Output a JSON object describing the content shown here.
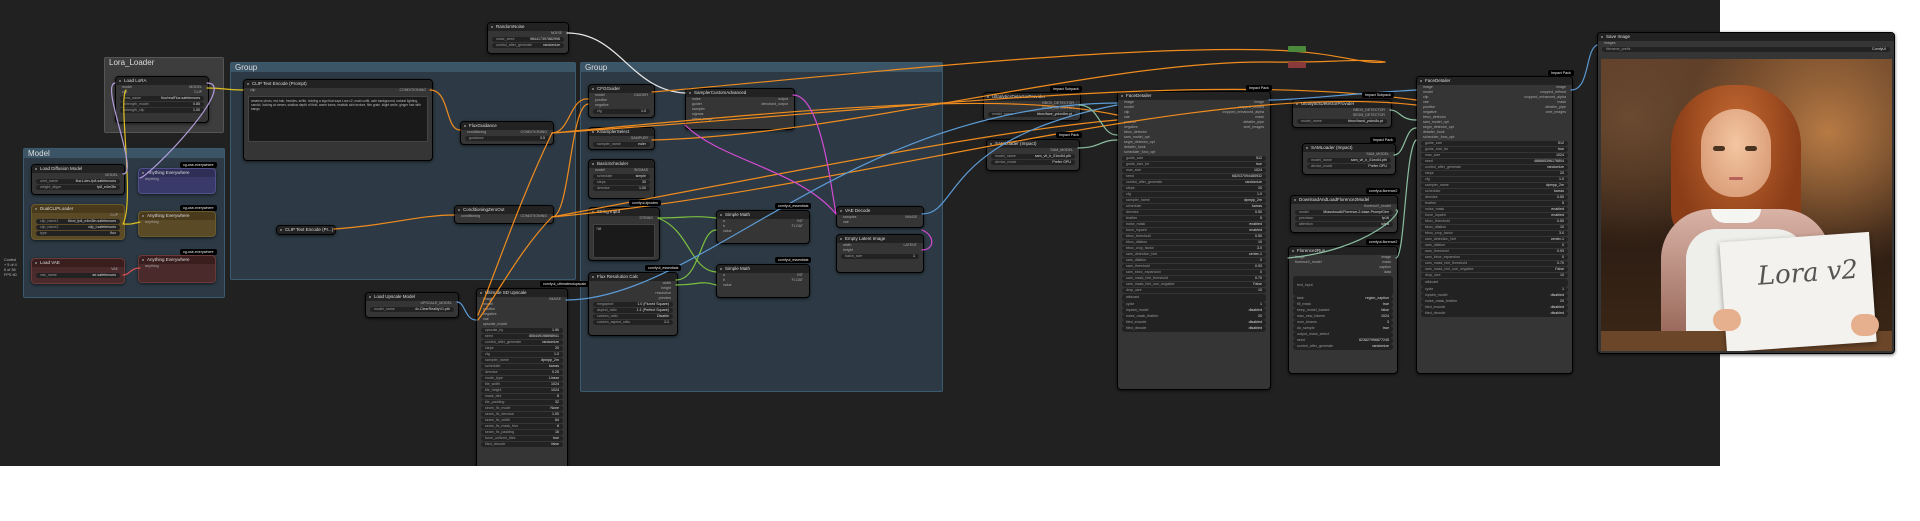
{
  "groups": {
    "lora": "Lora_Loader",
    "group1": "Group",
    "group2": "Group",
    "model": "Model"
  },
  "nodes": {
    "random_noise": {
      "title": "RandomNoise",
      "out": "NOISE",
      "w1": [
        "noise_seed",
        "984417397882996"
      ],
      "w2": [
        "control_after_generate",
        "randomize"
      ]
    },
    "load_lora": {
      "title": "Load LoRA",
      "ins": [
        "model",
        "clip"
      ],
      "outs": [
        "MODEL",
        "CLIP"
      ],
      "w1": [
        "lora_name",
        "flux/realFlux.safetensors"
      ],
      "w2": [
        "strength_model",
        "0.85"
      ],
      "w3": [
        "strength_clip",
        "1.00"
      ]
    },
    "clip_text": {
      "title": "CLIP Text Encode (Prompt)",
      "in": "clip",
      "out": "CONDITIONING",
      "text": "amateur photo, red-hair, freckles, selfie, holding a sign that says Lora v2, maid outfit, cafe background, natural lighting, candid, looking at viewer, shallow depth of field, warm tones, realistic skin texture, film grain, slight smile, ginger hair with bangs"
    },
    "flux_guidance": {
      "title": "FluxGuidance",
      "in": "conditioning",
      "out": "CONDITIONING",
      "w1": [
        "guidance",
        "3.5"
      ]
    },
    "cond_zero": {
      "title": "ConditioningZeroOut",
      "in": "conditioning",
      "out": "CONDITIONING"
    },
    "clip_text_neg": {
      "title": "CLIP Text Encode (Pr...)"
    },
    "load_diffusion": {
      "title": "Load Diffusion Model",
      "out": "MODEL",
      "w1": [
        "unet_name",
        "flux1-dev-fp8.safetensors"
      ],
      "w2": [
        "weight_dtype",
        "fp8_e4m3fn"
      ]
    },
    "dual_clip": {
      "title": "DualCLIPLoader",
      "out": "CLIP",
      "w1": [
        "clip_name1",
        "t5xxl_fp8_e4m3fn.safetensors"
      ],
      "w2": [
        "clip_name2",
        "clip_l.safetensors"
      ],
      "w3": [
        "type",
        "flux"
      ]
    },
    "load_vae": {
      "title": "Load VAE",
      "out": "VAE",
      "w1": [
        "vae_name",
        "ae.safetensors"
      ]
    },
    "anything_1": {
      "title": "Anything Everywhere",
      "in": "anything"
    },
    "anything_2": {
      "title": "Anything Everywhere",
      "in": "anything"
    },
    "anything_3": {
      "title": "Anything Everywhere",
      "in": "anything"
    },
    "cfg_guider": {
      "title": "CFGGuider",
      "ins": [
        "model",
        "positive",
        "negative"
      ],
      "out": "GUIDER",
      "w1": [
        "cfg",
        "1.0"
      ]
    },
    "ksampler_select": {
      "title": "KSamplerSelect",
      "out": "SAMPLER",
      "w1": [
        "sampler_name",
        "euler"
      ]
    },
    "basic_scheduler": {
      "title": "BasicScheduler",
      "in": "model",
      "out": "SIGMAS",
      "w1": [
        "scheduler",
        "simple"
      ],
      "w2": [
        "steps",
        "30"
      ],
      "w3": [
        "denoise",
        "1.00"
      ]
    },
    "sampler_custom": {
      "title": "SamplerCustomAdvanced",
      "ins": [
        "noise",
        "guider",
        "sampler",
        "sigmas",
        "latent_image"
      ],
      "outs": [
        "output",
        "denoised_output"
      ]
    },
    "string_input": {
      "title": "String Input",
      "out": "STRING",
      "text": "768"
    },
    "simple_math_1": {
      "title": "Simple Math",
      "ins": [
        "a",
        "b",
        "value"
      ],
      "outs": [
        "INT",
        "FLOAT"
      ]
    },
    "simple_math_2": {
      "title": "Simple Math",
      "ins": [
        "a",
        "b",
        "value"
      ],
      "outs": [
        "INT",
        "FLOAT"
      ]
    },
    "vae_decode": {
      "title": "VAE Decode",
      "ins": [
        "samples",
        "vae"
      ],
      "out": "IMAGE"
    },
    "empty_latent": {
      "title": "Empty Latent Image",
      "ins": [
        "width",
        "height"
      ],
      "out": "LATENT",
      "w1": [
        "batch_size",
        "1"
      ]
    },
    "flux_resolution": {
      "title": "Flux Resolution Calc",
      "outs": [
        "width",
        "height",
        "resolution",
        "preview"
      ],
      "w1": [
        "megapixel",
        "1.0 (Fluxed Square)"
      ],
      "w2": [
        "aspect_ratio",
        "1:1 (Perfect Square)"
      ],
      "w3": [
        "custom_ratio",
        "Disable"
      ],
      "w4": [
        "custom_aspect_ratio",
        "1:1"
      ]
    },
    "load_upscale": {
      "title": "Load Upscale Model",
      "out": "UPSCALE_MODEL",
      "w1": [
        "model_name",
        "4x-ClearRealityV1.pth"
      ]
    },
    "ultimate_sd": {
      "title": "Ultimate SD Upscale",
      "ins": [
        "image",
        "model",
        "positive",
        "negative",
        "vae",
        "upscale_model"
      ],
      "out": "IMAGE",
      "widgets": [
        [
          "upscale_by",
          "1.50"
        ],
        [
          "seed",
          "855449198698941"
        ],
        [
          "control_after_generate",
          "randomize"
        ],
        [
          "steps",
          "20"
        ],
        [
          "cfg",
          "1.0"
        ],
        [
          "sampler_name",
          "dpmpp_2m"
        ],
        [
          "scheduler",
          "karras"
        ],
        [
          "denoise",
          "0.25"
        ],
        [
          "mode_type",
          "Linear"
        ],
        [
          "tile_width",
          "1024"
        ],
        [
          "tile_height",
          "1024"
        ],
        [
          "mask_blur",
          "8"
        ],
        [
          "tile_padding",
          "32"
        ],
        [
          "seam_fix_mode",
          "None"
        ],
        [
          "seam_fix_denoise",
          "1.00"
        ],
        [
          "seam_fix_width",
          "64"
        ],
        [
          "seam_fix_mask_blur",
          "8"
        ],
        [
          "seam_fix_padding",
          "16"
        ],
        [
          "force_uniform_tiles",
          "true"
        ],
        [
          "tiled_decode",
          "false"
        ]
      ]
    },
    "ultra_provider_1": {
      "title": "UltralyticsDetectorProvider",
      "outs": [
        "BBOX_DETECTOR",
        "SEGM_DETECTOR"
      ],
      "w1": [
        "model_name",
        "bbox/face_yolov8m.pt"
      ]
    },
    "sam_loader_1": {
      "title": "SAMLoader (Impact)",
      "out": "SAM_MODEL",
      "w1": [
        "model_name",
        "sam_vit_b_01ec64.pth"
      ],
      "w2": [
        "device_mode",
        "Prefer GPU"
      ]
    },
    "face_detailer_1": {
      "title": "FaceDetailer",
      "ins": [
        "image",
        "model",
        "clip",
        "vae",
        "positive",
        "negative",
        "bbox_detector",
        "sam_model_opt",
        "segm_detector_opt",
        "detailer_hook",
        "scheduler_func_opt"
      ],
      "outs": [
        "image",
        "cropped_refined",
        "cropped_enhanced_alpha",
        "mask",
        "detailer_pipe",
        "cnet_images"
      ],
      "widgets": [
        [
          "guide_size",
          "512"
        ],
        [
          "guide_size_for",
          "true"
        ],
        [
          "max_size",
          "1024"
        ],
        [
          "seed",
          "682037094485932"
        ],
        [
          "control_after_generate",
          "randomize"
        ],
        [
          "steps",
          "20"
        ],
        [
          "cfg",
          "1.0"
        ],
        [
          "sampler_name",
          "dpmpp_2m"
        ],
        [
          "scheduler",
          "karras"
        ],
        [
          "denoise",
          "0.50"
        ],
        [
          "feather",
          "5"
        ],
        [
          "noise_mask",
          "enabled"
        ],
        [
          "force_inpaint",
          "enabled"
        ],
        [
          "bbox_threshold",
          "0.50"
        ],
        [
          "bbox_dilation",
          "10"
        ],
        [
          "bbox_crop_factor",
          "3.0"
        ],
        [
          "sam_detection_hint",
          "center-1"
        ],
        [
          "sam_dilation",
          "0"
        ],
        [
          "sam_threshold",
          "0.93"
        ],
        [
          "sam_bbox_expansion",
          "0"
        ],
        [
          "sam_mask_hint_threshold",
          "0.70"
        ],
        [
          "sam_mask_hint_use_negative",
          "False"
        ],
        [
          "drop_size",
          "10"
        ]
      ],
      "wildcard": [
        "wildcard",
        ""
      ],
      "extra": [
        [
          "cycle",
          "1"
        ],
        [
          "inpaint_model",
          "disabled"
        ],
        [
          "noise_mask_feather",
          "20"
        ],
        [
          "tiled_encode",
          "disabled"
        ],
        [
          "tiled_decode",
          "disabled"
        ]
      ]
    },
    "ultra_provider_2": {
      "title": "UltralyticsDetectorProvider",
      "outs": [
        "BBOX_DETECTOR",
        "SEGM_DETECTOR"
      ],
      "w1": [
        "model_name",
        "bbox/hand_yolov8s.pt"
      ]
    },
    "sam_loader_2": {
      "title": "SAMLoader (Impact)",
      "out": "SAM_MODEL",
      "w1": [
        "model_name",
        "sam_vit_b_01ec64.pth"
      ],
      "w2": [
        "device_mode",
        "Prefer GPU"
      ]
    },
    "downloader": {
      "title": "DownloadAndLoadFlorence2Model",
      "out": "florence2_model",
      "w1": [
        "model",
        "MiaoshouAI/Florence-2-base-PromptGen"
      ],
      "w2": [
        "precision",
        "fp16"
      ],
      "w3": [
        "attention",
        "sdpa"
      ]
    },
    "florence_run": {
      "title": "Florence2Run",
      "ins": [
        "image",
        "florence2_model"
      ],
      "outs": [
        "image",
        "mask",
        "caption",
        "data"
      ],
      "widgets": [
        [
          "text_input",
          ""
        ],
        [
          "task",
          "region_caption"
        ],
        [
          "fill_mask",
          "true"
        ],
        [
          "keep_model_loaded",
          "false"
        ],
        [
          "max_new_tokens",
          "1024"
        ],
        [
          "num_beams",
          "3"
        ],
        [
          "do_sample",
          "true"
        ],
        [
          "output_mask_select",
          ""
        ],
        [
          "seed",
          "823827996877245"
        ],
        [
          "control_after_generate",
          "randomize"
        ]
      ]
    },
    "face_detailer_2": {
      "title": "FaceDetailer",
      "ins": [
        "image",
        "model",
        "clip",
        "vae",
        "positive",
        "negative",
        "bbox_detector",
        "sam_model_opt",
        "segm_detector_opt",
        "detailer_hook",
        "scheduler_func_opt"
      ],
      "outs": [
        "image",
        "cropped_refined",
        "cropped_enhanced_alpha",
        "mask",
        "detailer_pipe",
        "cnet_images"
      ],
      "widgets": [
        [
          "guide_size",
          "512"
        ],
        [
          "guide_size_for",
          "true"
        ],
        [
          "max_size",
          "1024"
        ],
        [
          "seed",
          "488665396178804"
        ],
        [
          "control_after_generate",
          "randomize"
        ],
        [
          "steps",
          "20"
        ],
        [
          "cfg",
          "1.0"
        ],
        [
          "sampler_name",
          "dpmpp_2m"
        ],
        [
          "scheduler",
          "karras"
        ],
        [
          "denoise",
          "0.50"
        ],
        [
          "feather",
          "5"
        ],
        [
          "noise_mask",
          "enabled"
        ],
        [
          "force_inpaint",
          "enabled"
        ],
        [
          "bbox_threshold",
          "0.50"
        ],
        [
          "bbox_dilation",
          "10"
        ],
        [
          "bbox_crop_factor",
          "3.0"
        ],
        [
          "sam_detection_hint",
          "center-1"
        ],
        [
          "sam_dilation",
          "0"
        ],
        [
          "sam_threshold",
          "0.93"
        ],
        [
          "sam_bbox_expansion",
          "0"
        ],
        [
          "sam_mask_hint_threshold",
          "0.70"
        ],
        [
          "sam_mask_hint_use_negative",
          "False"
        ],
        [
          "drop_size",
          "10"
        ]
      ],
      "wildcard": [
        "wildcard",
        ""
      ],
      "extra": [
        [
          "cycle",
          "1"
        ],
        [
          "inpaint_model",
          "disabled"
        ],
        [
          "noise_mask_feather",
          "20"
        ],
        [
          "tiled_encode",
          "disabled"
        ],
        [
          "tiled_decode",
          "disabled"
        ]
      ]
    },
    "save_image": {
      "title": "Save Image",
      "in": "images",
      "w1": [
        "filename_prefix",
        "ComfyUI"
      ],
      "sign_text": "Lora v2"
    }
  },
  "badges": {
    "cg1": "cg-use-everywhere",
    "cg2": "cg-use-everywhere",
    "cg3": "cg-use-everywhere",
    "impact1": "Impact Subpack",
    "impact2": "Impact Pack",
    "impact3": "Impact Subpack",
    "impact4": "Impact Pack",
    "impact5": "Impact Pack",
    "florence1": "comfyui-florence2",
    "florence2": "comfyui-florence2",
    "mathA": "comfyui_essentials",
    "mathB": "comfyui_essentials",
    "kj": "comfyui-kjnodes",
    "usd": "comfyui_ultimatesdupscale"
  },
  "side_text": [
    "Control",
    "+ 5 of 4",
    "6 of 38",
    "FPS 60"
  ]
}
